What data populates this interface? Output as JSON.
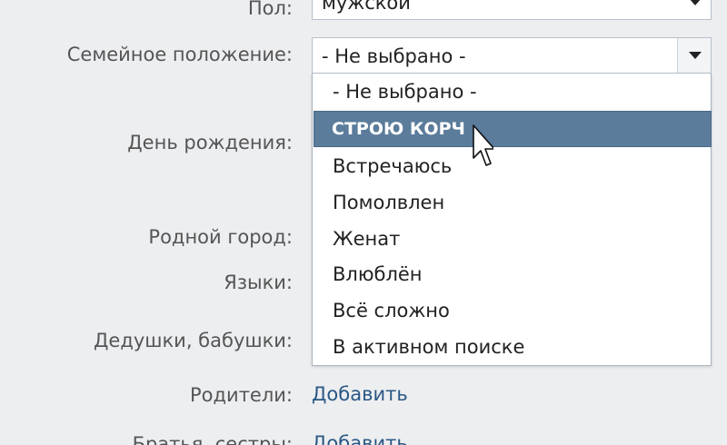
{
  "form": {
    "gender": {
      "label": "Пол:",
      "value": "мужской"
    },
    "marital": {
      "label": "Семейное положение:",
      "value": "- Не выбрано -",
      "options": [
        "- Не выбрано -",
        "СТРОЮ КОРЧ",
        "Встречаюсь",
        "Помолвлен",
        "Женат",
        "Влюблён",
        "Всё сложно",
        "В активном поиске"
      ],
      "highlighted_option": "СТРОЮ КОРЧ"
    },
    "birthday": {
      "label": "День рождения:"
    },
    "hometown": {
      "label": "Родной город:"
    },
    "languages": {
      "label": "Языки:"
    },
    "grandparents": {
      "label": "Дедушки, бабушки:"
    },
    "parents": {
      "label": "Родители:",
      "action": "Добавить"
    },
    "siblings": {
      "label": "Братья, сестры:",
      "action": "Добавить"
    }
  },
  "colors": {
    "background": "#edeef0",
    "highlight": "#5b7c9b",
    "link": "#2a5885",
    "label": "#555555"
  }
}
